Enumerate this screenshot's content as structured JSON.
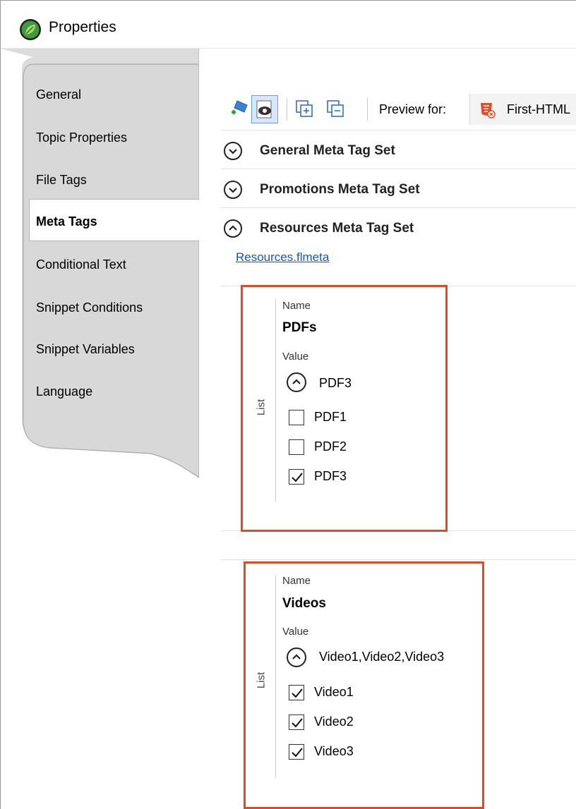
{
  "window": {
    "title": "Properties"
  },
  "sidebar": {
    "items": [
      {
        "label": "General",
        "active": false
      },
      {
        "label": "Topic Properties",
        "active": false
      },
      {
        "label": "File Tags",
        "active": false
      },
      {
        "label": "Meta Tags",
        "active": true
      },
      {
        "label": "Conditional Text",
        "active": false
      },
      {
        "label": "Snippet Conditions",
        "active": false
      },
      {
        "label": "Snippet Variables",
        "active": false
      },
      {
        "label": "Language",
        "active": false
      }
    ]
  },
  "toolbar": {
    "buttons": [
      {
        "icon": "apply-meta-tag-icon"
      },
      {
        "icon": "preview-eye-icon",
        "pressed": true
      },
      {
        "icon": "expand-all-icon"
      },
      {
        "icon": "collapse-all-icon"
      }
    ],
    "preview_label": "Preview for:",
    "preview_target": "First-HTML",
    "preview_target_icon": "html5-target-icon"
  },
  "sections": [
    {
      "label": "General Meta Tag Set",
      "expanded": false,
      "icon": "chevron-down-icon"
    },
    {
      "label": "Promotions Meta Tag Set",
      "expanded": false,
      "icon": "chevron-down-icon"
    },
    {
      "label": "Resources Meta Tag Set",
      "expanded": true,
      "icon": "chevron-up-icon"
    }
  ],
  "resources": {
    "file_link": "Resources.flmeta",
    "tags": [
      {
        "type_label": "List",
        "name_label": "Name",
        "name": "PDFs",
        "value_label": "Value",
        "current_value": "PDF3",
        "options": [
          {
            "label": "PDF1",
            "checked": false
          },
          {
            "label": "PDF2",
            "checked": false
          },
          {
            "label": "PDF3",
            "checked": true
          }
        ]
      },
      {
        "type_label": "List",
        "name_label": "Name",
        "name": "Videos",
        "value_label": "Value",
        "current_value": "Video1,Video2,Video3",
        "options": [
          {
            "label": "Video1",
            "checked": true
          },
          {
            "label": "Video2",
            "checked": true
          },
          {
            "label": "Video3",
            "checked": true
          }
        ]
      }
    ]
  },
  "colors": {
    "highlight": "#e04b26",
    "link": "#1a55b8",
    "sidebar_bg": "#f0f0f0",
    "app_icon": "#2e8b3a"
  }
}
